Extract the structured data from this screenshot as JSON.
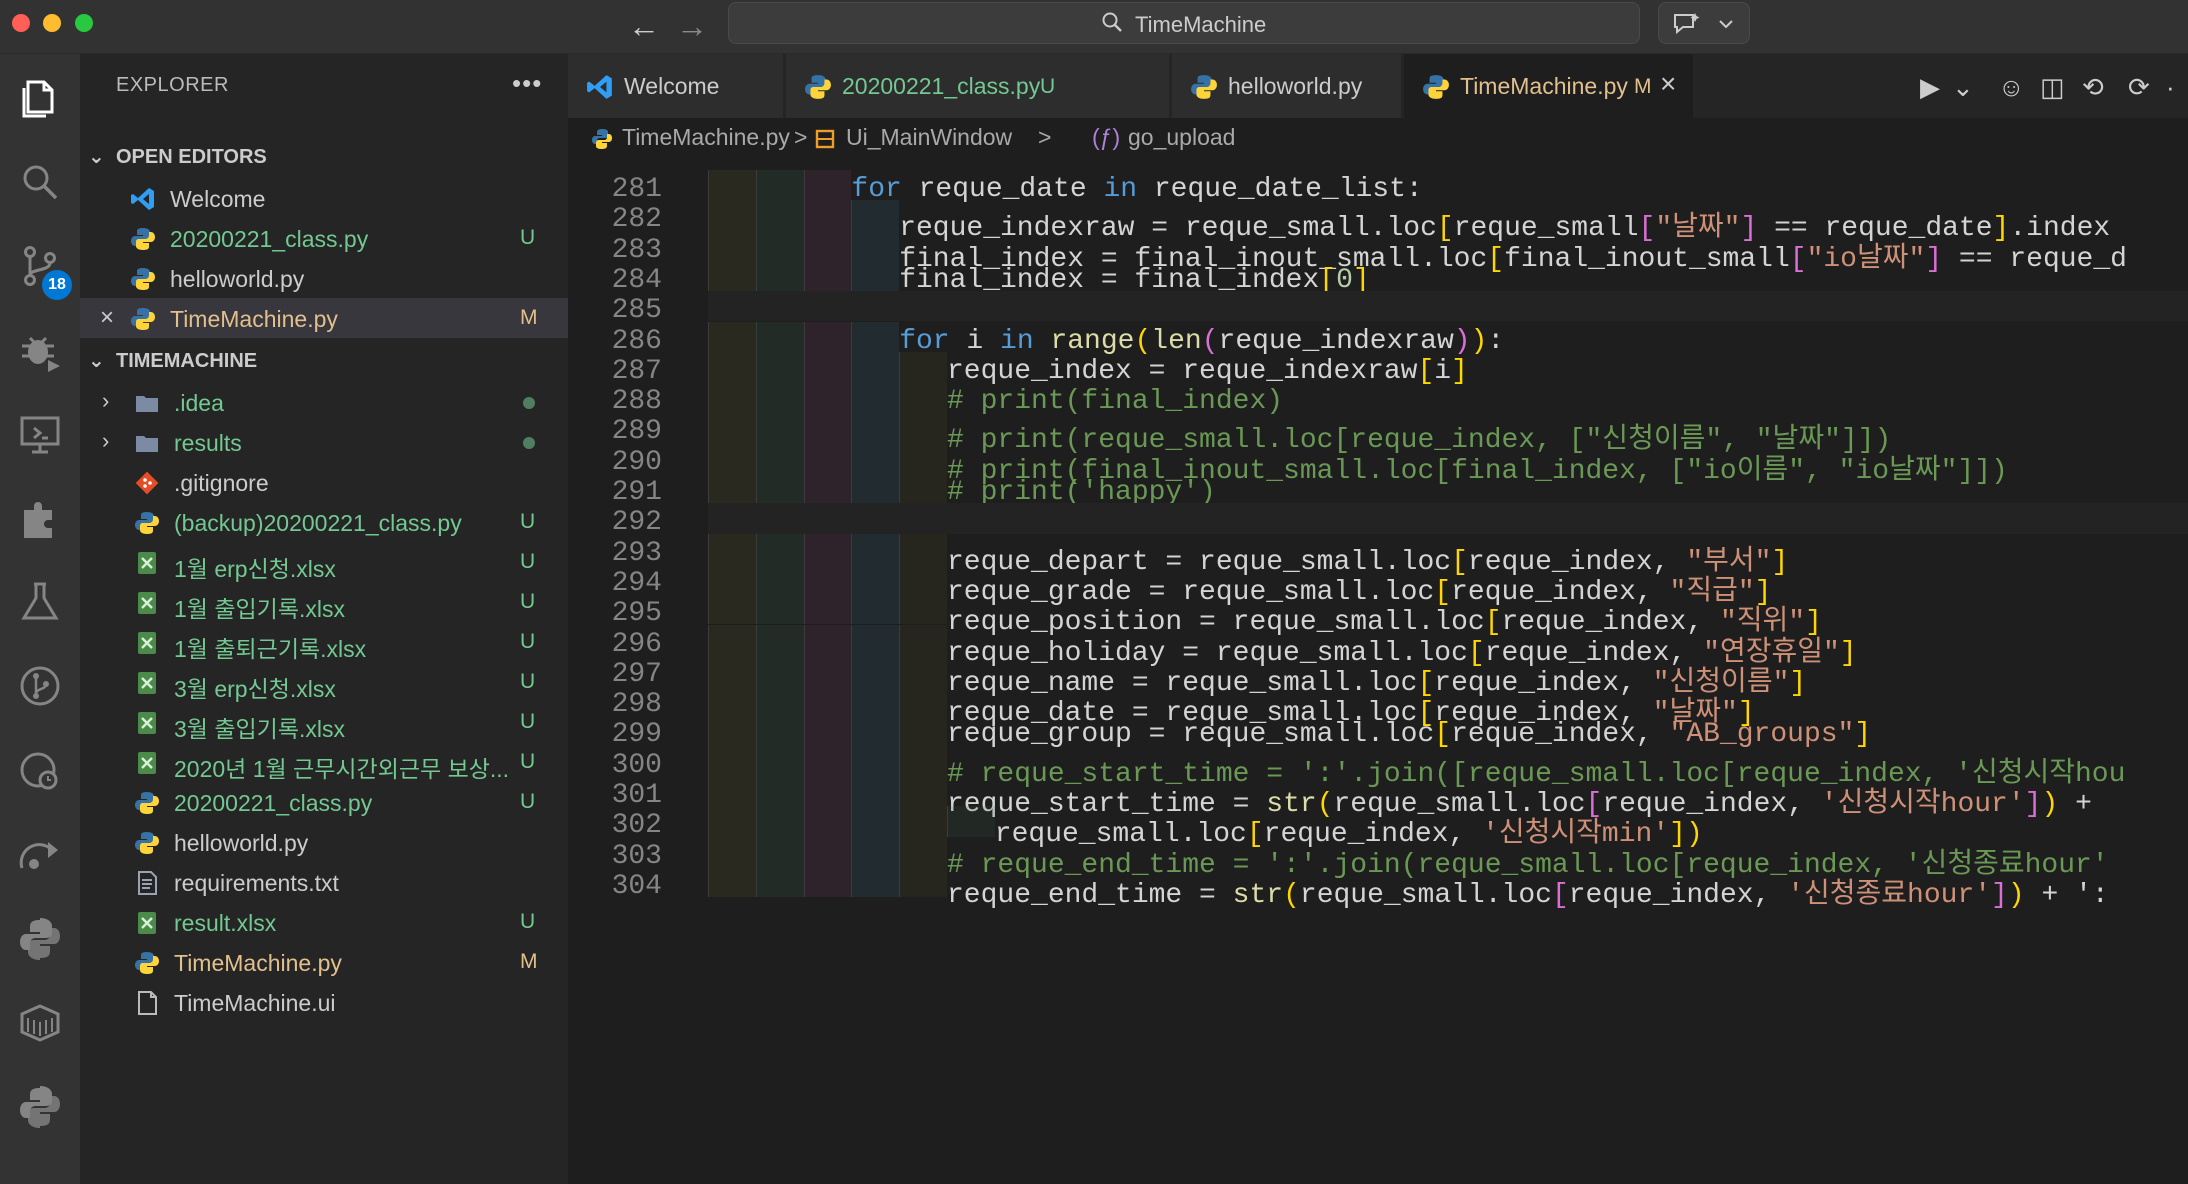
{
  "titlebar": {
    "back": "←",
    "forward": "→",
    "search_label": "TimeMachine"
  },
  "activity": {
    "scm_badge": "18"
  },
  "sidebar": {
    "title": "EXPLORER",
    "more": "•••",
    "open_editors_header": "OPEN EDITORS",
    "open_editors": [
      {
        "label": "Welcome",
        "status": "",
        "color": "white",
        "icon": "vscode-icon"
      },
      {
        "label": "20200221_class.py",
        "status": "U",
        "color": "green",
        "icon": "python-icon"
      },
      {
        "label": "helloworld.py",
        "status": "",
        "color": "white",
        "icon": "python-icon"
      },
      {
        "label": "TimeMachine.py",
        "status": "M",
        "color": "yellow",
        "icon": "python-icon"
      }
    ],
    "project_header": "TIMEMACHINE",
    "files": [
      {
        "label": ".idea",
        "status": "",
        "color": "green",
        "icon": "folder-icon"
      },
      {
        "label": "results",
        "status": "",
        "color": "green",
        "icon": "folder-icon"
      },
      {
        "label": ".gitignore",
        "status": "",
        "color": "white",
        "icon": "git-icon"
      },
      {
        "label": "(backup)20200221_class.py",
        "status": "U",
        "color": "green",
        "icon": "python-icon"
      },
      {
        "label": "1월 erp신청.xlsx",
        "status": "U",
        "color": "green",
        "icon": "excel-icon"
      },
      {
        "label": "1월 출입기록.xlsx",
        "status": "U",
        "color": "green",
        "icon": "excel-icon"
      },
      {
        "label": "1월 출퇴근기록.xlsx",
        "status": "U",
        "color": "green",
        "icon": "excel-icon"
      },
      {
        "label": "3월 erp신청.xlsx",
        "status": "U",
        "color": "green",
        "icon": "excel-icon"
      },
      {
        "label": "3월 출입기록.xlsx",
        "status": "U",
        "color": "green",
        "icon": "excel-icon"
      },
      {
        "label": "2020년 1월 근무시간외근무 보상...",
        "status": "U",
        "color": "green",
        "icon": "excel-icon"
      },
      {
        "label": "20200221_class.py",
        "status": "U",
        "color": "green",
        "icon": "python-icon"
      },
      {
        "label": "helloworld.py",
        "status": "",
        "color": "white",
        "icon": "python-icon"
      },
      {
        "label": "requirements.txt",
        "status": "",
        "color": "white",
        "icon": "text-icon"
      },
      {
        "label": "result.xlsx",
        "status": "U",
        "color": "green",
        "icon": "excel-icon"
      },
      {
        "label": "TimeMachine.py",
        "status": "M",
        "color": "yellow",
        "icon": "python-icon"
      },
      {
        "label": "TimeMachine.ui",
        "status": "",
        "color": "white",
        "icon": "file-icon"
      }
    ]
  },
  "tabs": [
    {
      "label": "Welcome",
      "mark": "",
      "color": "#cccccc",
      "icon": "vscode-icon"
    },
    {
      "label": "20200221_class.py",
      "mark": "U",
      "color": "#73c991",
      "icon": "python-icon"
    },
    {
      "label": "helloworld.py",
      "mark": "",
      "color": "#cccccc",
      "icon": "python-icon"
    },
    {
      "label": "TimeMachine.py",
      "mark": "M",
      "color": "#e2c08d",
      "icon": "python-icon"
    }
  ],
  "breadcrumb": {
    "file": "TimeMachine.py",
    "sep": ">",
    "cls": "Ui_MainWindow",
    "func_icon": "(ƒ)",
    "func": "go_upload"
  },
  "editor": {
    "lines": [
      {
        "num": "281",
        "indent": 3,
        "tokens": [
          [
            "k",
            "for"
          ],
          [
            "v",
            " reque_date "
          ],
          [
            "k",
            "in"
          ],
          [
            "v",
            " reque_date_list:"
          ]
        ]
      },
      {
        "num": "282",
        "indent": 4,
        "tokens": [
          [
            "v",
            "reque_indexraw = reque_small.loc"
          ],
          [
            "b1",
            "["
          ],
          [
            "v",
            "reque_small"
          ],
          [
            "b2",
            "["
          ],
          [
            "s",
            "\"날짜\""
          ],
          [
            "b2",
            "]"
          ],
          [
            "v",
            " == reque_date"
          ],
          [
            "b1",
            "]"
          ],
          [
            "v",
            ".index"
          ]
        ]
      },
      {
        "num": "283",
        "indent": 4,
        "tokens": [
          [
            "v",
            "final_index = final_inout_small.loc"
          ],
          [
            "b1",
            "["
          ],
          [
            "v",
            "final_inout_small"
          ],
          [
            "b2",
            "["
          ],
          [
            "s",
            "\"io날짜\""
          ],
          [
            "b2",
            "]"
          ],
          [
            "v",
            " == reque_d"
          ]
        ]
      },
      {
        "num": "284",
        "indent": 4,
        "tokens": [
          [
            "v",
            "final_index = final_index"
          ],
          [
            "b1",
            "["
          ],
          [
            "n",
            "0"
          ],
          [
            "b1",
            "]"
          ]
        ]
      },
      {
        "num": "285",
        "indent": -1,
        "tokens": []
      },
      {
        "num": "286",
        "indent": 4,
        "tokens": [
          [
            "k",
            "for"
          ],
          [
            "v",
            " i "
          ],
          [
            "k",
            "in"
          ],
          [
            "v",
            " "
          ],
          [
            "f",
            "range"
          ],
          [
            "b1",
            "("
          ],
          [
            "f",
            "len"
          ],
          [
            "b2",
            "("
          ],
          [
            "v",
            "reque_indexraw"
          ],
          [
            "b2",
            ")"
          ],
          [
            "b1",
            ")"
          ],
          [
            "v",
            ":"
          ]
        ]
      },
      {
        "num": "287",
        "indent": 5,
        "tokens": [
          [
            "v",
            "reque_index = reque_indexraw"
          ],
          [
            "b1",
            "["
          ],
          [
            "v",
            "i"
          ],
          [
            "b1",
            "]"
          ]
        ]
      },
      {
        "num": "288",
        "indent": 5,
        "tokens": [
          [
            "cm",
            "# print(final_index)"
          ]
        ]
      },
      {
        "num": "289",
        "indent": 5,
        "tokens": [
          [
            "cm",
            "# print(reque_small.loc[reque_index, [\"신청이름\", \"날짜\"]])"
          ]
        ]
      },
      {
        "num": "290",
        "indent": 5,
        "tokens": [
          [
            "cm",
            "# print(final_inout_small.loc[final_index, [\"io이름\", \"io날짜\"]])"
          ]
        ]
      },
      {
        "num": "291",
        "indent": 5,
        "tokens": [
          [
            "cm",
            "# print('happy')"
          ]
        ]
      },
      {
        "num": "292",
        "indent": -1,
        "tokens": []
      },
      {
        "num": "293",
        "indent": 5,
        "tokens": [
          [
            "v",
            "reque_depart = reque_small.loc"
          ],
          [
            "b1",
            "["
          ],
          [
            "v",
            "reque_index, "
          ],
          [
            "s",
            "\"부서\""
          ],
          [
            "b1",
            "]"
          ]
        ]
      },
      {
        "num": "294",
        "indent": 5,
        "tokens": [
          [
            "v",
            "reque_grade = reque_small.loc"
          ],
          [
            "b1",
            "["
          ],
          [
            "v",
            "reque_index, "
          ],
          [
            "s",
            "\"직급\""
          ],
          [
            "b1",
            "]"
          ]
        ]
      },
      {
        "num": "295",
        "indent": 5,
        "tokens": [
          [
            "v",
            "reque_position = reque_small.loc"
          ],
          [
            "b1",
            "["
          ],
          [
            "v",
            "reque_index, "
          ],
          [
            "s",
            "\"직위\""
          ],
          [
            "b1",
            "]"
          ]
        ]
      },
      {
        "num": "296",
        "indent": 5,
        "tokens": [
          [
            "v",
            "reque_holiday = reque_small.loc"
          ],
          [
            "b1",
            "["
          ],
          [
            "v",
            "reque_index, "
          ],
          [
            "s",
            "\"연장휴일\""
          ],
          [
            "b1",
            "]"
          ]
        ]
      },
      {
        "num": "297",
        "indent": 5,
        "tokens": [
          [
            "v",
            "reque_name = reque_small.loc"
          ],
          [
            "b1",
            "["
          ],
          [
            "v",
            "reque_index, "
          ],
          [
            "s",
            "\"신청이름\""
          ],
          [
            "b1",
            "]"
          ]
        ]
      },
      {
        "num": "298",
        "indent": 5,
        "tokens": [
          [
            "v",
            "reque_date = reque_small.loc"
          ],
          [
            "b1",
            "["
          ],
          [
            "v",
            "reque_index, "
          ],
          [
            "s",
            "\"날짜\""
          ],
          [
            "b1",
            "]"
          ]
        ]
      },
      {
        "num": "299",
        "indent": 5,
        "tokens": [
          [
            "v",
            "reque_group = reque_small.loc"
          ],
          [
            "b1",
            "["
          ],
          [
            "v",
            "reque_index, "
          ],
          [
            "s",
            "\"AB_groups\""
          ],
          [
            "b1",
            "]"
          ]
        ]
      },
      {
        "num": "300",
        "indent": 5,
        "tokens": [
          [
            "cm",
            "# reque_start_time = ':'.join([reque_small.loc[reque_index, '신청시작hou"
          ]
        ]
      },
      {
        "num": "301",
        "indent": 5,
        "tokens": [
          [
            "v",
            "reque_start_time = "
          ],
          [
            "f",
            "str"
          ],
          [
            "b1",
            "("
          ],
          [
            "v",
            "reque_small.loc"
          ],
          [
            "b2",
            "["
          ],
          [
            "v",
            "reque_index, "
          ],
          [
            "s",
            "'신청시작hour'"
          ],
          [
            "b2",
            "]"
          ],
          [
            "b1",
            ")"
          ],
          [
            "v",
            " +"
          ]
        ]
      },
      {
        "num": "302",
        "indent": 6,
        "tokens": [
          [
            "v",
            "reque_small.loc"
          ],
          [
            "b1",
            "["
          ],
          [
            "v",
            "reque_index, "
          ],
          [
            "s",
            "'신청시작min'"
          ],
          [
            "b1",
            "]"
          ],
          [
            "b1",
            ")"
          ]
        ]
      },
      {
        "num": "303",
        "indent": 5,
        "tokens": [
          [
            "cm",
            "# reque_end_time = ':'.join(reque_small.loc[reque_index, '신청종료hour'"
          ]
        ]
      },
      {
        "num": "304",
        "indent": 5,
        "tokens": [
          [
            "v",
            "reque_end_time = "
          ],
          [
            "f",
            "str"
          ],
          [
            "b1",
            "("
          ],
          [
            "v",
            "reque_small.loc"
          ],
          [
            "b2",
            "["
          ],
          [
            "v",
            "reque_index, "
          ],
          [
            "s",
            "'신청종료hour'"
          ],
          [
            "b2",
            "]"
          ],
          [
            "b1",
            ")"
          ],
          [
            "v",
            " + ':"
          ]
        ]
      }
    ]
  }
}
